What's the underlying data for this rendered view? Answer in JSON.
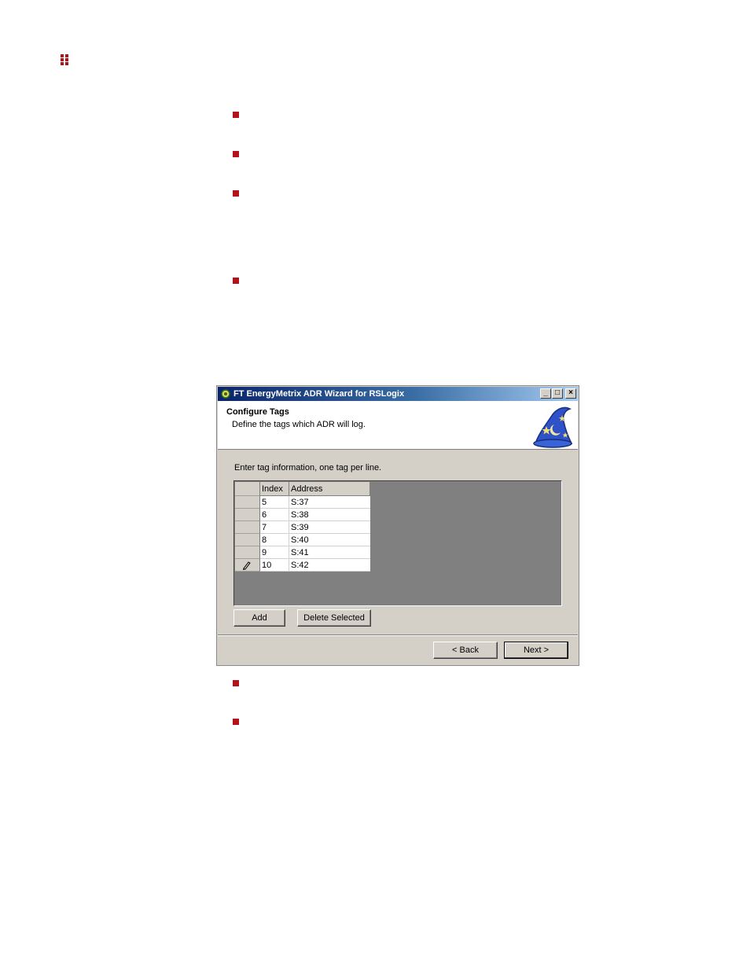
{
  "window": {
    "title": "FT EnergyMetrix ADR Wizard for RSLogix",
    "header_title": "Configure Tags",
    "header_subtitle": "Define the tags which ADR will log.",
    "instruction": "Enter tag information, one tag per line."
  },
  "grid": {
    "columns": [
      "Index",
      "Address"
    ],
    "rows": [
      {
        "index": "5",
        "address": "S:37"
      },
      {
        "index": "6",
        "address": "S:38"
      },
      {
        "index": "7",
        "address": "S:39"
      },
      {
        "index": "8",
        "address": "S:40"
      },
      {
        "index": "9",
        "address": "S:41"
      },
      {
        "index": "10",
        "address": "S:42"
      }
    ]
  },
  "buttons": {
    "add": "Add",
    "delete_selected": "Delete Selected",
    "back": "< Back",
    "next": "Next >"
  },
  "colors": {
    "bullet": "#b3121a",
    "title_gradient_start": "#0a246a"
  }
}
